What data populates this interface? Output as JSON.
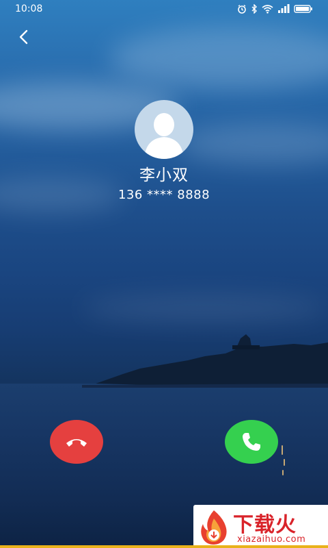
{
  "status_bar": {
    "time": "10:08",
    "icons": [
      "alarm-icon",
      "bluetooth-icon",
      "wifi-icon",
      "signal-icon",
      "battery-icon"
    ]
  },
  "header": {
    "back_icon": "chevron-left-icon"
  },
  "caller": {
    "name": "李小双",
    "number": "136 **** 8888"
  },
  "actions": {
    "decline_icon": "hang-up-icon",
    "accept_icon": "phone-icon"
  },
  "colors": {
    "decline": "#e5403f",
    "accept": "#35d04f",
    "watermark_red": "#d9232a"
  },
  "watermark": {
    "title": "下载火",
    "url": "xiazaihuo.com"
  }
}
